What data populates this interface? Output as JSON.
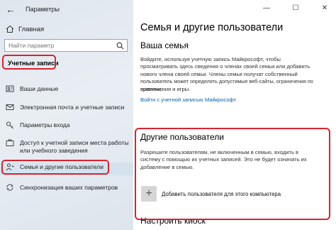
{
  "window": {
    "title": "Параметры",
    "controls": {
      "minimize": "—",
      "maximize": "☐",
      "close": "✕"
    }
  },
  "sidebar": {
    "back_glyph": "←",
    "home_label": "Главная",
    "search_placeholder": "Найти параметр",
    "section_title": "Учетные записи",
    "items": [
      {
        "label": "Ваши данные",
        "icon": "person-card-icon"
      },
      {
        "label": "Электронная почта и учетные записи",
        "icon": "mail-icon"
      },
      {
        "label": "Параметры входа",
        "icon": "key-icon"
      },
      {
        "label": "Доступ к учетной записи места работы",
        "label2": "или учебного заведения",
        "icon": "briefcase-icon"
      },
      {
        "label": "Семья и другие пользователи",
        "icon": "people-icon"
      },
      {
        "label": "Синхронизация ваших параметров",
        "icon": "sync-icon"
      }
    ]
  },
  "main": {
    "title": "Семья и другие пользователи",
    "family": {
      "heading": "Ваша семья",
      "description": "Войдите, используя учетную запись Майкрософт, чтобы просматривать здесь сведения о членах своей семьи или добавить нового члена своей семьи. Члены семьи получат собственные пользователь может определять допустимые веб-сайты, ограничения по времени, приложения и игры.",
      "line1": "Войдите, используя учетную запись Майкрософт, чтобы",
      "line2": "просматривать здесь сведения о членах своей семьи или добавить",
      "line3": "нового члена своей семьи. Члены семьи получат собственный",
      "line4": "пользователь может определять допустимые веб-сайты, ограничения по времени,",
      "line5": "приложения и игры.",
      "link": "Войти с учетной записью Майкрософт"
    },
    "others": {
      "heading": "Другие пользователи",
      "line1": "Разрешите пользователям, не включенным в семью, входить в",
      "line2": "систему с помощью их учетных записей. Это не будет означать их",
      "line3": "добавление в семью.",
      "add_label": "Добавить пользователя для этого компьютера",
      "add_glyph": "+"
    },
    "kiosk": {
      "heading": "Настроить киоск"
    }
  },
  "colors": {
    "highlight": "#d8242e",
    "link": "#0063b1"
  }
}
